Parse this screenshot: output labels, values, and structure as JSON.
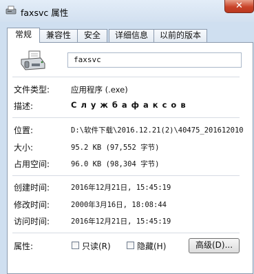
{
  "window": {
    "title": "faxsvc 属性",
    "close_label": "✕"
  },
  "tabs": [
    {
      "label": "常规",
      "active": true
    },
    {
      "label": "兼容性"
    },
    {
      "label": "安全"
    },
    {
      "label": "详细信息"
    },
    {
      "label": "以前的版本"
    }
  ],
  "general": {
    "file_name": "faxsvc",
    "file_type_label": "文件类型:",
    "file_type_value": "应用程序 (.exe)",
    "description_label": "描述:",
    "description_value": "С л у ж б а   ф а к с о в",
    "location_label": "位置:",
    "location_value": "D:\\软件下载\\2016.12.21(2)\\40475_201612010",
    "size_label": "大小:",
    "size_value": "95.2 KB (97,552 字节)",
    "disk_size_label": "占用空间:",
    "disk_size_value": "96.0 KB (98,304 字节)",
    "created_label": "创建时间:",
    "created_value": "2016年12月21日, 15:45:19",
    "modified_label": "修改时间:",
    "modified_value": "2000年3月16日, 18:08:44",
    "accessed_label": "访问时间:",
    "accessed_value": "2016年12月21日, 15:45:19",
    "attributes_label": "属性:",
    "readonly_label": "只读(R)",
    "hidden_label": "隐藏(H)",
    "advanced_label": "高级(D)..."
  }
}
